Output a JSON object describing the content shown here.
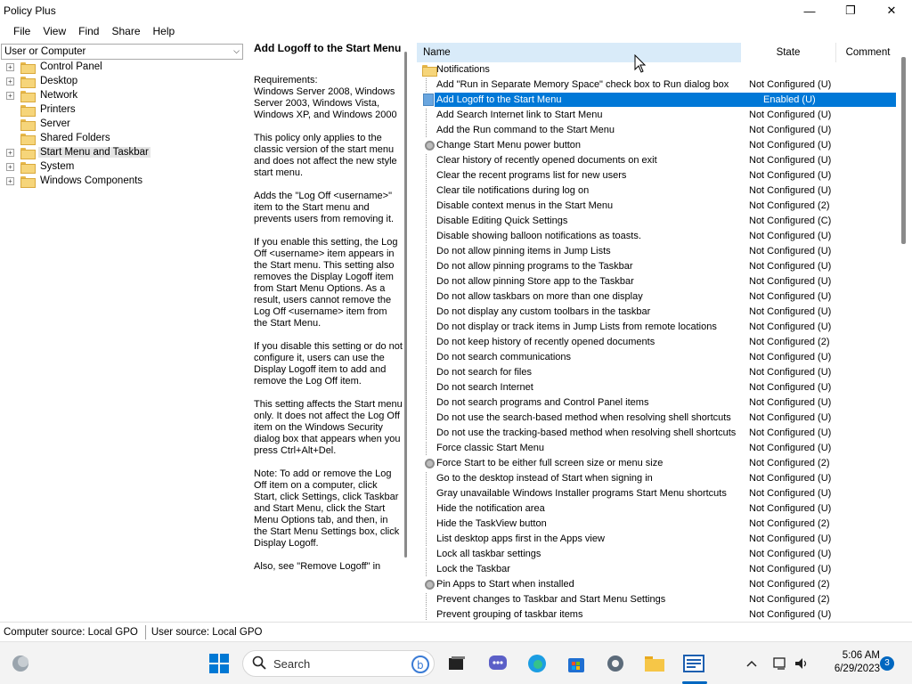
{
  "window": {
    "title": "Policy Plus",
    "minimize_icon": "—",
    "maximize_icon": "❐",
    "close_icon": "✕"
  },
  "menu": [
    "File",
    "View",
    "Find",
    "Share",
    "Help"
  ],
  "scope": {
    "value": "User or Computer",
    "dropdown_icon": "chevron-down-icon"
  },
  "tree": [
    {
      "label": "Control Panel",
      "expandable": true,
      "selected": false
    },
    {
      "label": "Desktop",
      "expandable": true,
      "selected": false
    },
    {
      "label": "Network",
      "expandable": true,
      "selected": false
    },
    {
      "label": "Printers",
      "expandable": false,
      "selected": false
    },
    {
      "label": "Server",
      "expandable": false,
      "selected": false
    },
    {
      "label": "Shared Folders",
      "expandable": false,
      "selected": false
    },
    {
      "label": "Start Menu and Taskbar",
      "expandable": true,
      "selected": true
    },
    {
      "label": "System",
      "expandable": true,
      "selected": false
    },
    {
      "label": "Windows Components",
      "expandable": true,
      "selected": false
    }
  ],
  "description": {
    "title": "Add Logoff to the Start Menu",
    "paragraphs": [
      "Requirements:\nWindows Server 2008, Windows Server 2003, Windows Vista, Windows XP, and Windows 2000",
      "This policy only applies to the classic version of the start menu and does not affect the new style start menu.",
      "Adds the \"Log Off <username>\" item to the Start menu and prevents users from removing it.",
      "If you enable this setting, the Log Off <username> item appears in the Start menu. This setting also removes the Display Logoff item from Start Menu Options. As a result, users cannot remove the Log Off <username> item from the Start Menu.",
      "If you disable this setting or do not configure it, users can use the Display Logoff item to add and remove the Log Off item.",
      "This setting affects the Start menu only. It does not affect the Log Off item on the Windows Security dialog box that appears when you press Ctrl+Alt+Del.",
      "Note: To add or remove the Log Off item on a computer, click Start, click Settings, click Taskbar and Start Menu, click the Start Menu Options tab, and then, in the Start Menu Settings box, click Display Logoff.",
      "Also, see \"Remove Logoff\" in"
    ]
  },
  "list": {
    "headers": {
      "name": "Name",
      "state": "State",
      "comment": "Comment"
    },
    "rows": [
      {
        "name": "Notifications",
        "state": "",
        "icon": "folder-icon",
        "selected": false
      },
      {
        "name": "Add \"Run in Separate Memory Space\" check box to Run dialog box",
        "state": "Not Configured (U)",
        "icon": "policy-icon",
        "selected": false
      },
      {
        "name": "Add Logoff to the Start Menu",
        "state": "Enabled (U)",
        "icon": "policy-icon",
        "selected": true
      },
      {
        "name": "Add Search Internet link to Start Menu",
        "state": "Not Configured (U)",
        "icon": "policy-icon",
        "selected": false
      },
      {
        "name": "Add the Run command to the Start Menu",
        "state": "Not Configured (U)",
        "icon": "policy-icon",
        "selected": false
      },
      {
        "name": "Change Start Menu power button",
        "state": "Not Configured (U)",
        "icon": "gear-icon",
        "selected": false
      },
      {
        "name": "Clear history of recently opened documents on exit",
        "state": "Not Configured (U)",
        "icon": "policy-icon",
        "selected": false
      },
      {
        "name": "Clear the recent programs list for new users",
        "state": "Not Configured (U)",
        "icon": "policy-icon",
        "selected": false
      },
      {
        "name": "Clear tile notifications during log on",
        "state": "Not Configured (U)",
        "icon": "policy-icon",
        "selected": false
      },
      {
        "name": "Disable context menus in the Start Menu",
        "state": "Not Configured (2)",
        "icon": "policy-icon",
        "selected": false
      },
      {
        "name": "Disable Editing Quick Settings",
        "state": "Not Configured (C)",
        "icon": "policy-icon",
        "selected": false
      },
      {
        "name": "Disable showing balloon notifications as toasts.",
        "state": "Not Configured (U)",
        "icon": "policy-icon",
        "selected": false
      },
      {
        "name": "Do not allow pinning items in Jump Lists",
        "state": "Not Configured (U)",
        "icon": "policy-icon",
        "selected": false
      },
      {
        "name": "Do not allow pinning programs to the Taskbar",
        "state": "Not Configured (U)",
        "icon": "policy-icon",
        "selected": false
      },
      {
        "name": "Do not allow pinning Store app to the Taskbar",
        "state": "Not Configured (U)",
        "icon": "policy-icon",
        "selected": false
      },
      {
        "name": "Do not allow taskbars on more than one display",
        "state": "Not Configured (U)",
        "icon": "policy-icon",
        "selected": false
      },
      {
        "name": "Do not display any custom toolbars in the taskbar",
        "state": "Not Configured (U)",
        "icon": "policy-icon",
        "selected": false
      },
      {
        "name": "Do not display or track items in Jump Lists from remote locations",
        "state": "Not Configured (U)",
        "icon": "policy-icon",
        "selected": false
      },
      {
        "name": "Do not keep history of recently opened documents",
        "state": "Not Configured (2)",
        "icon": "policy-icon",
        "selected": false
      },
      {
        "name": "Do not search communications",
        "state": "Not Configured (U)",
        "icon": "policy-icon",
        "selected": false
      },
      {
        "name": "Do not search for files",
        "state": "Not Configured (U)",
        "icon": "policy-icon",
        "selected": false
      },
      {
        "name": "Do not search Internet",
        "state": "Not Configured (U)",
        "icon": "policy-icon",
        "selected": false
      },
      {
        "name": "Do not search programs and Control Panel items",
        "state": "Not Configured (U)",
        "icon": "policy-icon",
        "selected": false
      },
      {
        "name": "Do not use the search-based method when resolving shell shortcuts",
        "state": "Not Configured (U)",
        "icon": "policy-icon",
        "selected": false
      },
      {
        "name": "Do not use the tracking-based method when resolving shell shortcuts",
        "state": "Not Configured (U)",
        "icon": "policy-icon",
        "selected": false
      },
      {
        "name": "Force classic Start Menu",
        "state": "Not Configured (U)",
        "icon": "policy-icon",
        "selected": false
      },
      {
        "name": "Force Start to be either full screen size or menu size",
        "state": "Not Configured (2)",
        "icon": "gear-icon",
        "selected": false
      },
      {
        "name": "Go to the desktop instead of Start when signing in",
        "state": "Not Configured (U)",
        "icon": "policy-icon",
        "selected": false
      },
      {
        "name": "Gray unavailable Windows Installer programs Start Menu shortcuts",
        "state": "Not Configured (U)",
        "icon": "policy-icon",
        "selected": false
      },
      {
        "name": "Hide the notification area",
        "state": "Not Configured (U)",
        "icon": "policy-icon",
        "selected": false
      },
      {
        "name": "Hide the TaskView button",
        "state": "Not Configured (2)",
        "icon": "policy-icon",
        "selected": false
      },
      {
        "name": "List desktop apps first in the Apps view",
        "state": "Not Configured (U)",
        "icon": "policy-icon",
        "selected": false
      },
      {
        "name": "Lock all taskbar settings",
        "state": "Not Configured (U)",
        "icon": "policy-icon",
        "selected": false
      },
      {
        "name": "Lock the Taskbar",
        "state": "Not Configured (U)",
        "icon": "policy-icon",
        "selected": false
      },
      {
        "name": "Pin Apps to Start when installed",
        "state": "Not Configured (2)",
        "icon": "gear-icon",
        "selected": false
      },
      {
        "name": "Prevent changes to Taskbar and Start Menu Settings",
        "state": "Not Configured (2)",
        "icon": "policy-icon",
        "selected": false
      },
      {
        "name": "Prevent grouping of taskbar items",
        "state": "Not Configured (U)",
        "icon": "policy-icon",
        "selected": false
      }
    ]
  },
  "status": {
    "computer_source": "Computer source:  Local GPO",
    "user_source": "User source:  Local GPO"
  },
  "taskbar": {
    "search_placeholder": "Search",
    "time": "5:06 AM",
    "date": "6/29/2023",
    "notification_count": "3"
  },
  "colors": {
    "selection": "#0078d7",
    "header_highlight": "#d9ebf9",
    "accent": "#0067c0"
  }
}
